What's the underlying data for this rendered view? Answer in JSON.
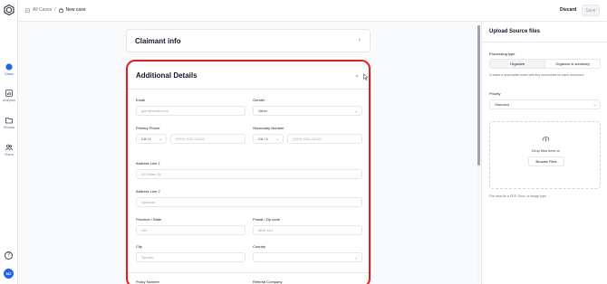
{
  "nav": {
    "items": [
      {
        "label": "Cases",
        "icon": "cases-icon",
        "active": true
      },
      {
        "label": "Analytics",
        "icon": "analytics-icon",
        "active": false
      },
      {
        "label": "Window",
        "icon": "window-icon",
        "active": false
      },
      {
        "label": "Teams",
        "icon": "teams-icon",
        "active": false
      }
    ],
    "help": "?",
    "avatar": "MZ"
  },
  "breadcrumb": {
    "root": "All Cases",
    "separator": "/",
    "current": "New case"
  },
  "toolbar": {
    "discard_label": "Discard",
    "save_label": "Save"
  },
  "sections": {
    "claimant_title": "Claimant info",
    "details_title": "Additional Details"
  },
  "form": {
    "email": {
      "label": "Email",
      "placeholder": "john@smith.com"
    },
    "gender": {
      "label": "Gender",
      "value": "Other"
    },
    "primary_phone": {
      "label": "Primary Phone",
      "code": "CA +1",
      "placeholder": "(XXX) XXX-XXXX"
    },
    "secondary_number": {
      "label": "Secondary Number",
      "code": "CA +1",
      "placeholder": "(XXX) XXX-XXXX"
    },
    "address1": {
      "label": "Address Line 1",
      "placeholder": "123 Main St"
    },
    "address2": {
      "label": "Address Line 2",
      "placeholder": "Optional"
    },
    "province": {
      "label": "Province / State",
      "placeholder": "ON"
    },
    "postal": {
      "label": "Postal / Zip code",
      "placeholder": "M5A 1A1"
    },
    "city": {
      "label": "City",
      "placeholder": "Toronto"
    },
    "country": {
      "label": "Country",
      "value": ""
    },
    "policy": {
      "label": "Policy Number"
    },
    "referral": {
      "label": "Referral Company"
    }
  },
  "upload": {
    "title": "Upload Source files",
    "processing_label": "Processing type",
    "options": [
      "Organize",
      "Organize & summary"
    ],
    "selected": "Organize",
    "help": "Creates a searchable index with key summaries for each document.",
    "priority_label": "Priority",
    "priority_value": "Standard",
    "drop_text": "Drop files here or",
    "browse_label": "Browse Files",
    "formats_note": "File must be a PDF, Docx, or image type."
  },
  "colors": {
    "accent": "#2563eb",
    "highlight": "#e11d1d"
  }
}
